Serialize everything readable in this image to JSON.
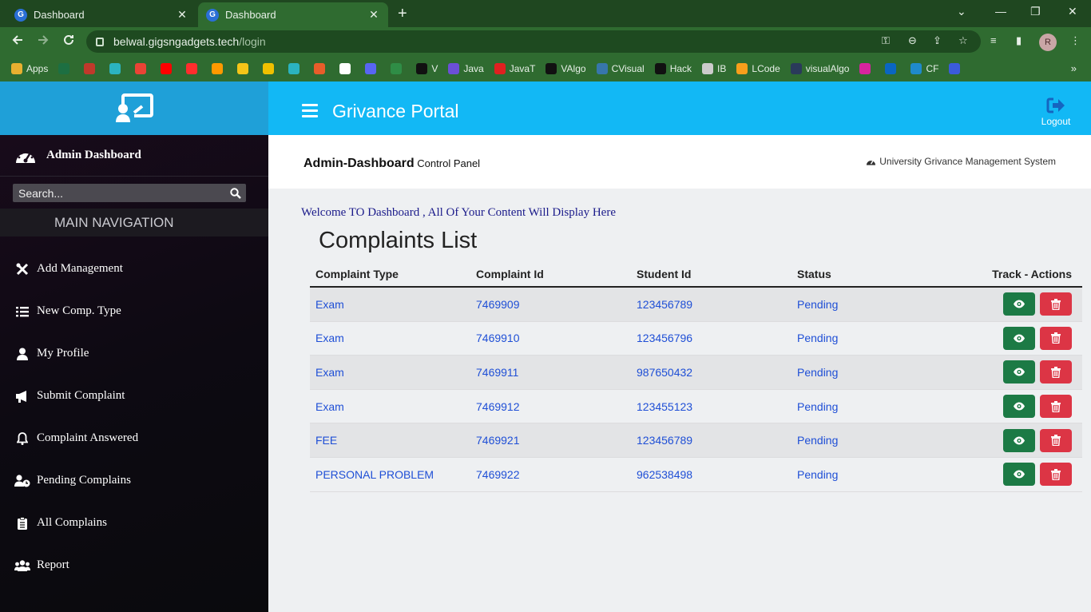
{
  "browser": {
    "tabs": [
      {
        "title": "Dashboard",
        "active": false
      },
      {
        "title": "Dashboard",
        "active": true
      }
    ],
    "url_host": "belwal.gigsngadgets.tech",
    "url_path": "/login",
    "profile_initial": "R",
    "bookmarks": [
      {
        "label": "Apps",
        "color": "#e8b030"
      },
      {
        "label": "",
        "color": "#1d6f42"
      },
      {
        "label": "",
        "color": "#c0392b"
      },
      {
        "label": "",
        "color": "#2bb3c0"
      },
      {
        "label": "",
        "color": "#ea4335"
      },
      {
        "label": "",
        "color": "#ff0000"
      },
      {
        "label": "",
        "color": "#ff2d2d"
      },
      {
        "label": "",
        "color": "#ff9900"
      },
      {
        "label": "",
        "color": "#f5c518"
      },
      {
        "label": "",
        "color": "#f0c000"
      },
      {
        "label": "",
        "color": "#2bb3c0"
      },
      {
        "label": "",
        "color": "#e85d2a"
      },
      {
        "label": "",
        "color": "#ffffff"
      },
      {
        "label": "",
        "color": "#5865f2"
      },
      {
        "label": "",
        "color": "#2f8d46"
      },
      {
        "label": "V",
        "color": "#111111"
      },
      {
        "label": "Java",
        "color": "#6b4fd6"
      },
      {
        "label": "JavaT",
        "color": "#e02020"
      },
      {
        "label": "VAlgo",
        "color": "#111111"
      },
      {
        "label": "CVisual",
        "color": "#3776ab"
      },
      {
        "label": "Hack",
        "color": "#111111"
      },
      {
        "label": "IB",
        "color": "#cccccc"
      },
      {
        "label": "LCode",
        "color": "#f89f1b"
      },
      {
        "label": "visualAlgo",
        "color": "#2a3a5a"
      },
      {
        "label": "",
        "color": "#d6249f"
      },
      {
        "label": "",
        "color": "#0a66c2"
      },
      {
        "label": "CF",
        "color": "#1f8acb"
      },
      {
        "label": "",
        "color": "#3b5bdb"
      }
    ]
  },
  "app": {
    "portal_title": "Grivance Portal",
    "logout_label": "Logout",
    "admin_label": "Admin Dashboard",
    "search_placeholder": "Search...",
    "main_nav_label": "MAIN NAVIGATION",
    "nav_items": [
      {
        "label": "Add Management",
        "icon": "tools-icon"
      },
      {
        "label": "New Comp. Type",
        "icon": "list-icon"
      },
      {
        "label": "My Profile",
        "icon": "user-icon"
      },
      {
        "label": "Submit Complaint",
        "icon": "megaphone-icon"
      },
      {
        "label": "Complaint Answered",
        "icon": "bell-icon"
      },
      {
        "label": "Pending Complains",
        "icon": "user-clock-icon"
      },
      {
        "label": "All Complains",
        "icon": "clipboard-icon"
      },
      {
        "label": "Report",
        "icon": "users-icon"
      }
    ],
    "header": {
      "title": "Admin-Dashboard",
      "subtitle": "Control Panel",
      "system_name": "University Grivance Management System"
    },
    "welcome_text": "Welcome TO Dashboard , All Of Your Content Will Display Here",
    "list_title": "Complaints List",
    "table": {
      "columns": [
        "Complaint Type",
        "Complaint Id",
        "Student Id",
        "Status",
        "Track - Actions"
      ],
      "rows": [
        {
          "type": "Exam",
          "complaint_id": "7469909",
          "student_id": "123456789",
          "status": "Pending"
        },
        {
          "type": "Exam",
          "complaint_id": "7469910",
          "student_id": "123456796",
          "status": "Pending"
        },
        {
          "type": "Exam",
          "complaint_id": "7469911",
          "student_id": "987650432",
          "status": "Pending"
        },
        {
          "type": "Exam",
          "complaint_id": "7469912",
          "student_id": "123455123",
          "status": "Pending"
        },
        {
          "type": "FEE",
          "complaint_id": "7469921",
          "student_id": "123456789",
          "status": "Pending"
        },
        {
          "type": "PERSONAL PROBLEM",
          "complaint_id": "7469922",
          "student_id": "962538498",
          "status": "Pending"
        }
      ]
    },
    "colors": {
      "brand": "#1fa0d8",
      "topbar": "#12b8f5",
      "view_button": "#1c7a45",
      "delete_button": "#dc3545",
      "link_text": "#1f4fd6"
    }
  }
}
